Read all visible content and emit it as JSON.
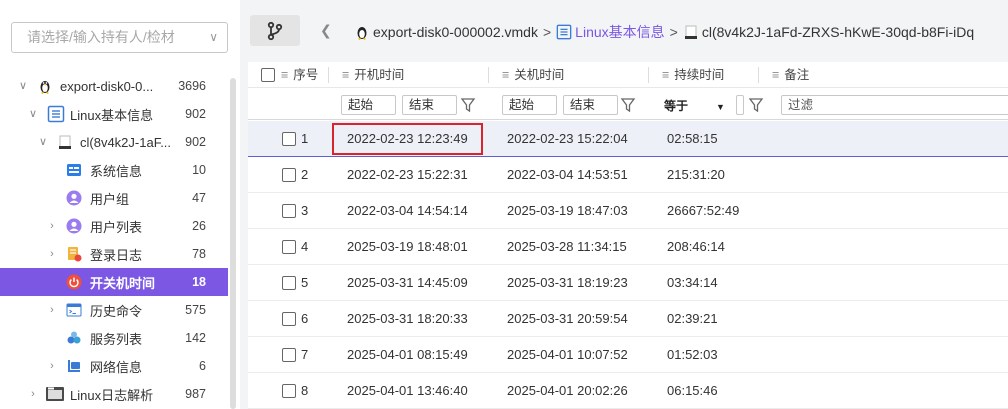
{
  "sidebar": {
    "owner_placeholder": "请选择/输入持有人/检材",
    "tree": [
      {
        "label": "export-disk0-0...",
        "count": "3696",
        "icon": "linux-icon",
        "expand": "open"
      },
      {
        "label": "Linux基本信息",
        "count": "902",
        "icon": "list-doc-icon",
        "expand": "open"
      },
      {
        "label": "cl(8v4k2J-1aF...",
        "count": "902",
        "icon": "disk-icon",
        "expand": "open"
      },
      {
        "label": "系统信息",
        "count": "10",
        "icon": "system-info-icon",
        "expand": ""
      },
      {
        "label": "用户组",
        "count": "47",
        "icon": "user-group-icon",
        "expand": ""
      },
      {
        "label": "用户列表",
        "count": "26",
        "icon": "user-list-icon",
        "expand": "closed"
      },
      {
        "label": "登录日志",
        "count": "78",
        "icon": "login-log-icon",
        "expand": "closed"
      },
      {
        "label": "开关机时间",
        "count": "18",
        "icon": "power-icon",
        "expand": "",
        "active": true
      },
      {
        "label": "历史命令",
        "count": "575",
        "icon": "terminal-icon",
        "expand": "closed"
      },
      {
        "label": "服务列表",
        "count": "142",
        "icon": "service-icon",
        "expand": ""
      },
      {
        "label": "网络信息",
        "count": "6",
        "icon": "network-icon",
        "expand": "closed"
      },
      {
        "label": "Linux日志解析",
        "count": "987",
        "icon": "log-parse-icon",
        "expand": "closed"
      }
    ]
  },
  "breadcrumb": {
    "items": [
      "export-disk0-000002.vmdk",
      "Linux基本信息",
      "cl(8v4k2J-1aFd-ZRXS-hKwE-30qd-b8Fi-iDq"
    ],
    "separator": ">"
  },
  "table": {
    "columns": [
      "序号",
      "开机时间",
      "关机时间",
      "持续时间",
      "备注"
    ],
    "filters": {
      "boot_start": "起始",
      "boot_end": "结束",
      "shutdown_start": "起始",
      "shutdown_end": "结束",
      "duration_op": "等于",
      "note_placeholder": "过滤"
    },
    "rows": [
      {
        "no": "1",
        "boot": "2022-02-23 12:23:49",
        "shutdown": "2022-02-23 15:22:04",
        "duration": "02:58:15"
      },
      {
        "no": "2",
        "boot": "2022-02-23 15:22:31",
        "shutdown": "2022-03-04 14:53:51",
        "duration": "215:31:20"
      },
      {
        "no": "3",
        "boot": "2022-03-04 14:54:14",
        "shutdown": "2025-03-19 18:47:03",
        "duration": "26667:52:49"
      },
      {
        "no": "4",
        "boot": "2025-03-19 18:48:01",
        "shutdown": "2025-03-28 11:34:15",
        "duration": "208:46:14"
      },
      {
        "no": "5",
        "boot": "2025-03-31 14:45:09",
        "shutdown": "2025-03-31 18:19:23",
        "duration": "03:34:14"
      },
      {
        "no": "6",
        "boot": "2025-03-31 18:20:33",
        "shutdown": "2025-03-31 20:59:54",
        "duration": "02:39:21"
      },
      {
        "no": "7",
        "boot": "2025-04-01 08:15:49",
        "shutdown": "2025-04-01 10:07:52",
        "duration": "01:52:03"
      },
      {
        "no": "8",
        "boot": "2025-04-01 13:46:40",
        "shutdown": "2025-04-01 20:02:26",
        "duration": "06:15:46"
      }
    ]
  },
  "colors": {
    "accent": "#7b57e4",
    "highlight": "#d9232d",
    "selected_row": "#eef0f8"
  }
}
